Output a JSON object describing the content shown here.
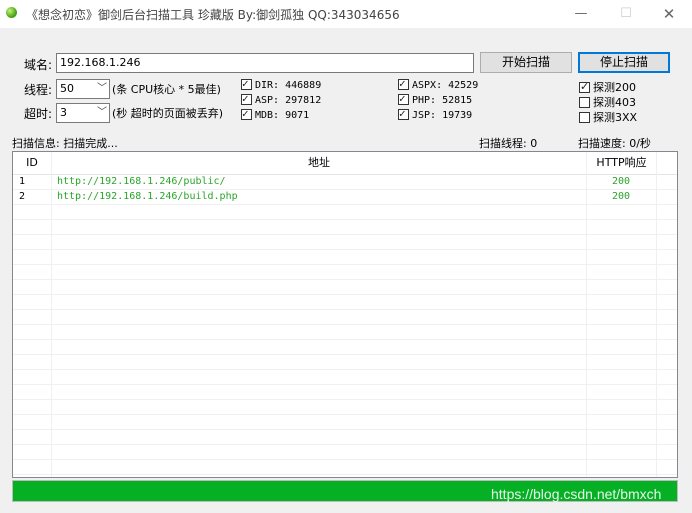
{
  "window": {
    "title": "《想念初恋》御剑后台扫描工具 珍藏版 By:御剑孤独 QQ:343034656",
    "min_glyph": "—",
    "max_glyph": "☐",
    "close_glyph": "✕"
  },
  "form": {
    "domain_label": "域名:",
    "domain_value": "192.168.1.246",
    "threads_label": "线程:",
    "threads_value": "50",
    "threads_hint": "(条 CPU核心 * 5最佳)",
    "timeout_label": "超时:",
    "timeout_value": "3",
    "timeout_hint": "(秒 超时的页面被丢弃)",
    "start_button": "开始扫描",
    "stop_button": "停止扫描"
  },
  "dictionaries": [
    {
      "label": "DIR: 446889",
      "checked": true
    },
    {
      "label": "ASP: 297812",
      "checked": true
    },
    {
      "label": "MDB: 9071",
      "checked": true
    },
    {
      "label": "ASPX: 42529",
      "checked": true
    },
    {
      "label": "PHP: 52815",
      "checked": true
    },
    {
      "label": "JSP: 19739",
      "checked": true
    }
  ],
  "probes": [
    {
      "label": "探测200",
      "checked": true
    },
    {
      "label": "探测403",
      "checked": false
    },
    {
      "label": "探测3XX",
      "checked": false
    }
  ],
  "status": {
    "scan_info": "扫描信息: 扫描完成...",
    "scan_threads": "扫描线程: 0",
    "scan_speed": "扫描速度: 0/秒"
  },
  "table": {
    "columns": [
      "ID",
      "地址",
      "HTTP响应"
    ],
    "rows": [
      {
        "id": "1",
        "url": "http://192.168.1.246/public/",
        "code": "200"
      },
      {
        "id": "2",
        "url": "http://192.168.1.246/build.php",
        "code": "200"
      }
    ]
  },
  "progress": {
    "value": 1.0
  },
  "watermark": "https://blog.csdn.net/bmxch",
  "colors": {
    "accent": "#06b025",
    "url_text": "#2aa52a",
    "code_text": "#2aa52a"
  }
}
